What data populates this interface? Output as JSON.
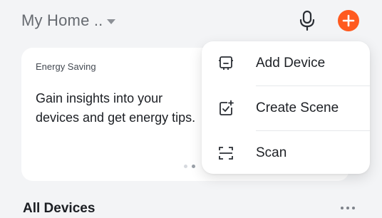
{
  "header": {
    "home_title": "My Home ..",
    "icons": {
      "dropdown": "chevron-down-icon",
      "voice": "microphone-icon",
      "add": "plus-icon"
    }
  },
  "energy_card": {
    "label": "Energy Saving",
    "text": "Gain insights into your devices and get energy tips.",
    "page_count": 2,
    "active_page": 2
  },
  "menu": {
    "items": [
      {
        "label": "Add Device",
        "icon": "add-device-icon"
      },
      {
        "label": "Create Scene",
        "icon": "create-scene-icon"
      },
      {
        "label": "Scan",
        "icon": "scan-icon"
      }
    ]
  },
  "devices_section": {
    "title": "All Devices",
    "more_icon": "more-icon"
  },
  "colors": {
    "accent": "#ff5a1f",
    "background": "#f3f4f6",
    "card": "#ffffff"
  }
}
